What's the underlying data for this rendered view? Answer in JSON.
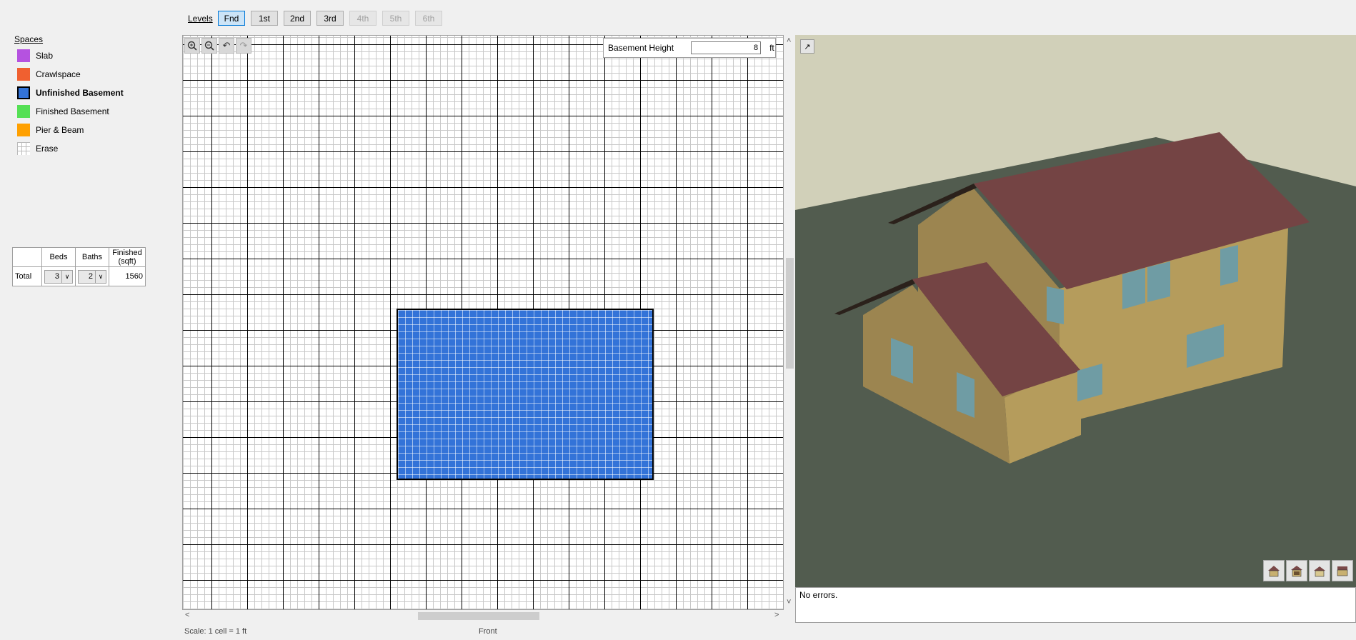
{
  "levels": {
    "label": "Levels",
    "buttons": [
      {
        "label": "Fnd",
        "state": "active"
      },
      {
        "label": "1st",
        "state": "normal"
      },
      {
        "label": "2nd",
        "state": "normal"
      },
      {
        "label": "3rd",
        "state": "normal"
      },
      {
        "label": "4th",
        "state": "disabled"
      },
      {
        "label": "5th",
        "state": "disabled"
      },
      {
        "label": "6th",
        "state": "disabled"
      }
    ]
  },
  "spaces": {
    "title": "Spaces",
    "items": [
      {
        "label": "Slab",
        "color": "#b552e0",
        "selected": false
      },
      {
        "label": "Crawlspace",
        "color": "#f06030",
        "selected": false
      },
      {
        "label": "Unfinished Basement",
        "color": "#3373d8",
        "selected": true
      },
      {
        "label": "Finished Basement",
        "color": "#55e055",
        "selected": false
      },
      {
        "label": "Pier & Beam",
        "color": "#ffa000",
        "selected": false
      },
      {
        "label": "Erase",
        "color": "grid",
        "selected": false
      }
    ]
  },
  "summary": {
    "headers": {
      "beds": "Beds",
      "baths": "Baths",
      "finished": "Finished (sqft)"
    },
    "row_label": "Total",
    "beds": "3",
    "baths": "2",
    "finished": "1560"
  },
  "editor": {
    "tools": [
      "zoom-in-icon",
      "zoom-out-icon",
      "undo-icon",
      "redo-icon"
    ],
    "basement_height_label": "Basement Height",
    "basement_height_value": "8",
    "basement_height_unit": "ft",
    "scale_label": "Scale: 1 cell = 1 ft",
    "view_label": "Front"
  },
  "viewer": {
    "sky_color": "#d1d0b9",
    "ground_color": "#525c4f",
    "wall_color": "#b59c5c",
    "roof_color": "#7a4848",
    "errors_text": "No errors."
  }
}
